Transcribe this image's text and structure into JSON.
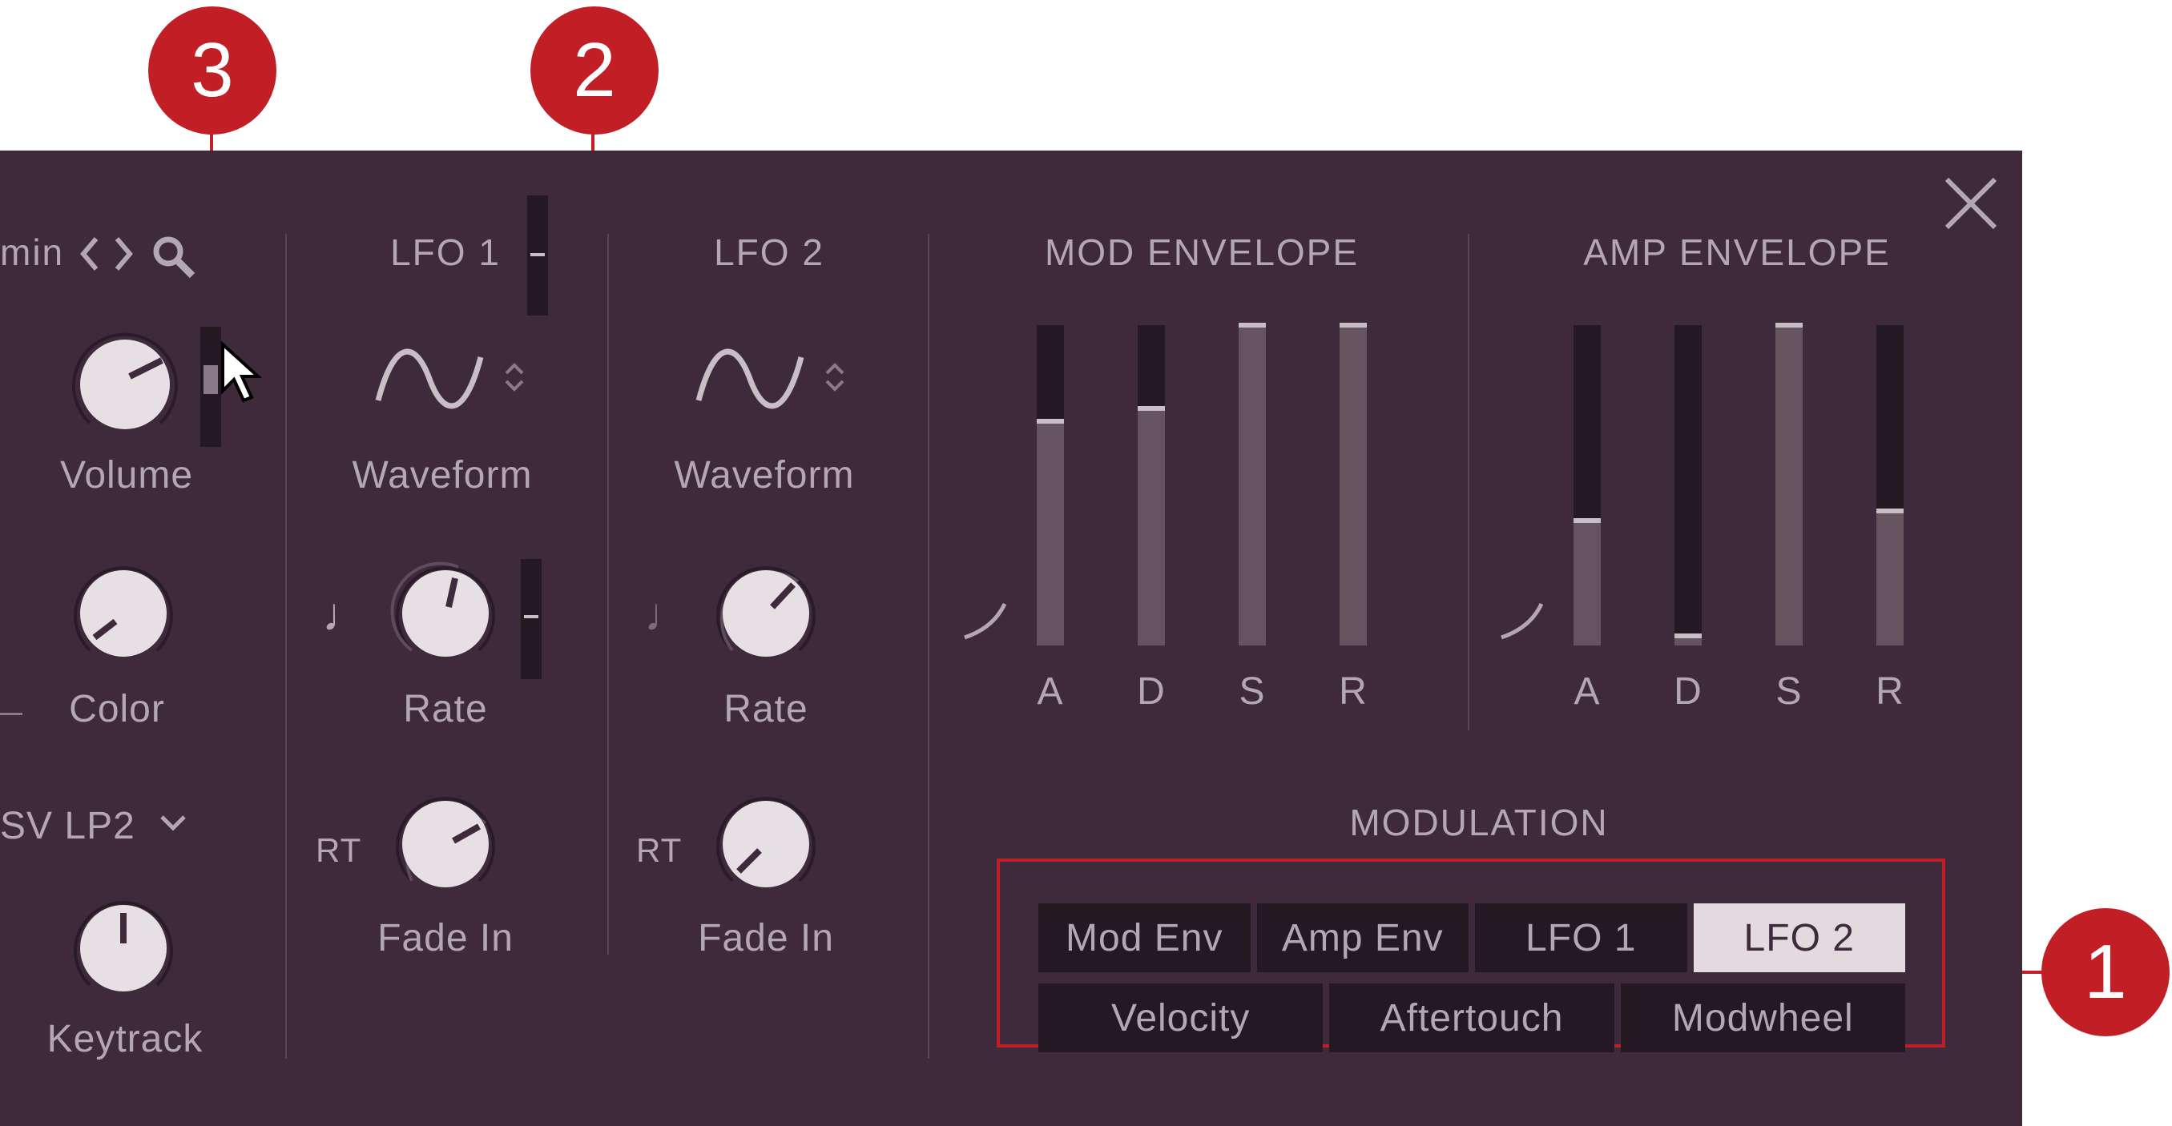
{
  "callouts": {
    "c1": "1",
    "c2": "2",
    "c3": "3"
  },
  "header": {
    "preset_fragment": "min",
    "prev_icon": "chevron-left-icon",
    "next_icon": "chevron-right-icon",
    "search_icon": "search-icon",
    "close_icon": "close-icon"
  },
  "voice": {
    "volume_label": "Volume",
    "color_label": "Color",
    "filter_type": "SV LP2",
    "keytrack_label": "Keytrack"
  },
  "lfo1": {
    "title": "LFO 1",
    "waveform_label": "Waveform",
    "rate_label": "Rate",
    "fade_label": "Fade In",
    "retrigger": "RT"
  },
  "lfo2": {
    "title": "LFO 2",
    "waveform_label": "Waveform",
    "rate_label": "Rate",
    "fade_label": "Fade In",
    "retrigger": "RT"
  },
  "mod_envelope": {
    "title": "MOD ENVELOPE",
    "stages": [
      {
        "label": "A",
        "level": 0.7
      },
      {
        "label": "D",
        "level": 0.74
      },
      {
        "label": "S",
        "level": 1.0
      },
      {
        "label": "R",
        "level": 1.0
      }
    ]
  },
  "amp_envelope": {
    "title": "AMP ENVELOPE",
    "stages": [
      {
        "label": "A",
        "level": 0.39
      },
      {
        "label": "D",
        "level": 0.03
      },
      {
        "label": "S",
        "level": 1.0
      },
      {
        "label": "R",
        "level": 0.42
      }
    ]
  },
  "modulation": {
    "title": "MODULATION",
    "row1": [
      "Mod Env",
      "Amp Env",
      "LFO 1",
      "LFO 2"
    ],
    "row2": [
      "Velocity",
      "Aftertouch",
      "Modwheel"
    ],
    "active": "LFO 2"
  },
  "colors": {
    "panel": "#3f2a3c",
    "text": "#b3a8b1",
    "callout": "#c11f25",
    "button_active": "#e2dadf"
  }
}
